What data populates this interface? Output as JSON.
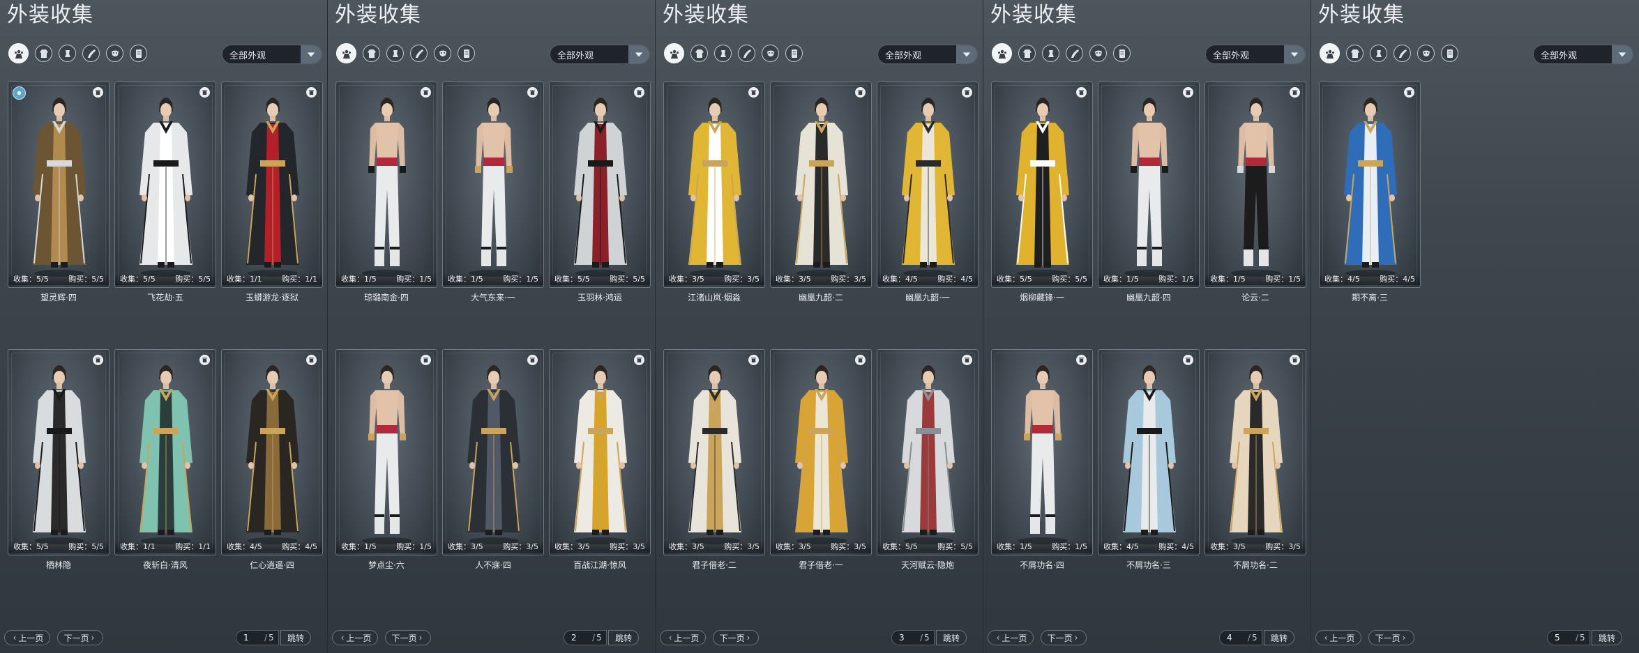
{
  "filter_icons": [
    "all-outfits-icon",
    "robe-icon",
    "hat-icon",
    "cape-icon",
    "mask-icon",
    "scroll-icon"
  ],
  "pages": [
    {
      "title": "外装收集",
      "filter": "全部外观",
      "page_number": "1",
      "page_total": "5",
      "prev_label": "上一页",
      "next_label": "下一页",
      "jump_label": "跳转",
      "cards": [
        {
          "name": "望灵辉·四",
          "collect": "收集：5/5",
          "buy": "购买：5/5",
          "palette": [
            "#6b5532",
            "#b08a4e",
            "#d8d8d8"
          ],
          "badge": true
        },
        {
          "name": "飞花劫·五",
          "collect": "收集：5/5",
          "buy": "购买：5/5",
          "palette": [
            "#e6e8ea",
            "#ffffff",
            "#1a1a1a"
          ]
        },
        {
          "name": "玉蟒游龙·逐狱",
          "collect": "收集：1/1",
          "buy": "购买：1/1",
          "palette": [
            "#23272b",
            "#b3202a",
            "#c9a45a"
          ]
        },
        {
          "name": "栖林隐",
          "collect": "收集：5/5",
          "buy": "购买：5/5",
          "palette": [
            "#d9dcdf",
            "#2a2a2a",
            "#1a1a1a"
          ]
        },
        {
          "name": "夜斩白·清风",
          "collect": "收集：1/1",
          "buy": "购买：1/1",
          "palette": [
            "#7fc2b0",
            "#2c3e3c",
            "#c9a45a"
          ]
        },
        {
          "name": "仁心逍遥·四",
          "collect": "收集：4/5",
          "buy": "购买：4/5",
          "palette": [
            "#2a2622",
            "#8a6a3a",
            "#c9a45a"
          ]
        }
      ]
    },
    {
      "title": "外装收集",
      "filter": "全部外观",
      "page_number": "2",
      "page_total": "5",
      "prev_label": "上一页",
      "next_label": "下一页",
      "jump_label": "跳转",
      "cards": [
        {
          "name": "琼璐南金·四",
          "collect": "收集：1/5",
          "buy": "购买：1/5",
          "palette": [
            "#e8eaec",
            "#b02a3a",
            "#1a1a1a"
          ],
          "shirtless": true
        },
        {
          "name": "大气东来·一",
          "collect": "收集：1/5",
          "buy": "购买：1/5",
          "palette": [
            "#e8eaec",
            "#b02a3a",
            "#c9a45a"
          ],
          "shirtless": true
        },
        {
          "name": "玉羽林·鸿运",
          "collect": "收集：5/5",
          "buy": "购买：5/5",
          "palette": [
            "#cfd3d6",
            "#8a2028",
            "#1a1a1a"
          ]
        },
        {
          "name": "梦点尘·六",
          "collect": "收集：1/5",
          "buy": "购买：1/5",
          "palette": [
            "#e8eaec",
            "#b02a3a",
            "#c9a45a"
          ],
          "shirtless": true
        },
        {
          "name": "人不寐·四",
          "collect": "收集：3/5",
          "buy": "购买：3/5",
          "palette": [
            "#2b2f36",
            "#515866",
            "#c9a45a"
          ]
        },
        {
          "name": "百战江湖·惊风",
          "collect": "收集：3/5",
          "buy": "购买：3/5",
          "palette": [
            "#eceae2",
            "#d7a42a",
            "#c9a45a"
          ]
        }
      ]
    },
    {
      "title": "外装收集",
      "filter": "全部外观",
      "page_number": "3",
      "page_total": "5",
      "prev_label": "上一页",
      "next_label": "下一页",
      "jump_label": "跳转",
      "cards": [
        {
          "name": "江渚山岚·烟淼",
          "collect": "收集：3/5",
          "buy": "购买：3/5",
          "palette": [
            "#e2b635",
            "#ffffff",
            "#c9a45a"
          ]
        },
        {
          "name": "幽凰九韶·二",
          "collect": "收集：3/5",
          "buy": "购买：3/5",
          "palette": [
            "#e6e2d6",
            "#2a2a2a",
            "#c9a45a"
          ]
        },
        {
          "name": "幽凰九韶·一",
          "collect": "收集：4/5",
          "buy": "购买：4/5",
          "palette": [
            "#e2b635",
            "#ece6d6",
            "#2a2a2a"
          ]
        },
        {
          "name": "君子借老·二",
          "collect": "收集：3/5",
          "buy": "购买：3/5",
          "palette": [
            "#e8e4da",
            "#c9a45a",
            "#2a2a2a"
          ]
        },
        {
          "name": "君子借老·一",
          "collect": "收集：3/5",
          "buy": "购买：3/5",
          "palette": [
            "#d8a436",
            "#ece6d6",
            "#c9a45a"
          ]
        },
        {
          "name": "天河赋云·隐炮",
          "collect": "收集：5/5",
          "buy": "购买：5/5",
          "palette": [
            "#d7d9dc",
            "#9a3a3a",
            "#8a8f96"
          ]
        }
      ]
    },
    {
      "title": "外装收集",
      "filter": "全部外观",
      "page_number": "4",
      "page_total": "5",
      "prev_label": "上一页",
      "next_label": "下一页",
      "jump_label": "跳转",
      "cards": [
        {
          "name": "烟柳藏锋·一",
          "collect": "收集：5/5",
          "buy": "购买：5/5",
          "palette": [
            "#e0b22e",
            "#1f1f1f",
            "#ffffff"
          ]
        },
        {
          "name": "幽凰九韶·四",
          "collect": "收集：1/5",
          "buy": "购买：1/5",
          "palette": [
            "#e8eaec",
            "#b02a3a",
            "#1a1a1a"
          ],
          "shirtless": true
        },
        {
          "name": "论云·二",
          "collect": "收集：1/5",
          "buy": "购买：1/5",
          "palette": [
            "#1c1c1c",
            "#b02a3a",
            "#d8d8d8"
          ],
          "shirtless": true
        },
        {
          "name": "不屑功名·四",
          "collect": "收集：1/5",
          "buy": "购买：1/5",
          "palette": [
            "#e8eaec",
            "#b02a3a",
            "#c9a45a"
          ],
          "shirtless": true
        },
        {
          "name": "不屑功名·三",
          "collect": "收集：4/5",
          "buy": "购买：4/5",
          "palette": [
            "#a8c8dc",
            "#e8eaec",
            "#1a1a1a"
          ]
        },
        {
          "name": "不屑功名·二",
          "collect": "收集：3/5",
          "buy": "购买：3/5",
          "palette": [
            "#e6d6bd",
            "#2a2a2a",
            "#c9a45a"
          ]
        }
      ]
    },
    {
      "title": "外装收集",
      "filter": "全部外观",
      "page_number": "5",
      "page_total": "5",
      "prev_label": "上一页",
      "next_label": "下一页",
      "jump_label": "跳转",
      "cards": [
        {
          "name": "期不离·三",
          "collect": "收集：4/5",
          "buy": "购买：4/5",
          "palette": [
            "#2f6db8",
            "#e8eef5",
            "#c9a45a"
          ]
        }
      ]
    }
  ]
}
